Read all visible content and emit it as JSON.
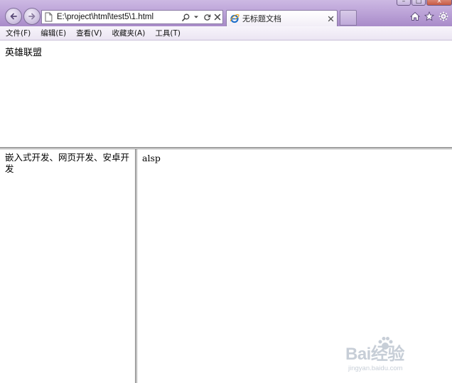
{
  "browser": {
    "address": "E:\\project\\html\\test5\\1.html",
    "tab_title": "无标题文档",
    "window_controls": {
      "minimize_icon": "minimize-icon",
      "maximize_icon": "maximize-icon",
      "close_icon": "close-icon"
    },
    "icons": {
      "back": "back-arrow-icon",
      "forward": "forward-arrow-icon",
      "page": "page-icon",
      "search": "search-icon",
      "dropdown": "chevron-down-icon",
      "refresh": "refresh-icon",
      "stop": "stop-icon",
      "ie": "ie-logo-icon",
      "home": "home-icon",
      "favorites": "star-icon",
      "tools": "gear-icon"
    }
  },
  "menu": {
    "items": [
      {
        "label": "文件(F)"
      },
      {
        "label": "编辑(E)"
      },
      {
        "label": "查看(V)"
      },
      {
        "label": "收藏夹(A)"
      },
      {
        "label": "工具(T)"
      }
    ]
  },
  "frames": {
    "top": {
      "text": "英雄联盟"
    },
    "left": {
      "text": "嵌入式开发、网页开发、安卓开发"
    },
    "right": {
      "text": "alsp"
    }
  },
  "watermark": {
    "brand": "Bai经验",
    "url": "jingyan.baidu.com"
  },
  "colors": {
    "chrome": "#b9a0d6",
    "menu_bg": "#f2eef7",
    "frame_border": "#7a7a7a",
    "ie_blue": "#1e6fc9"
  }
}
